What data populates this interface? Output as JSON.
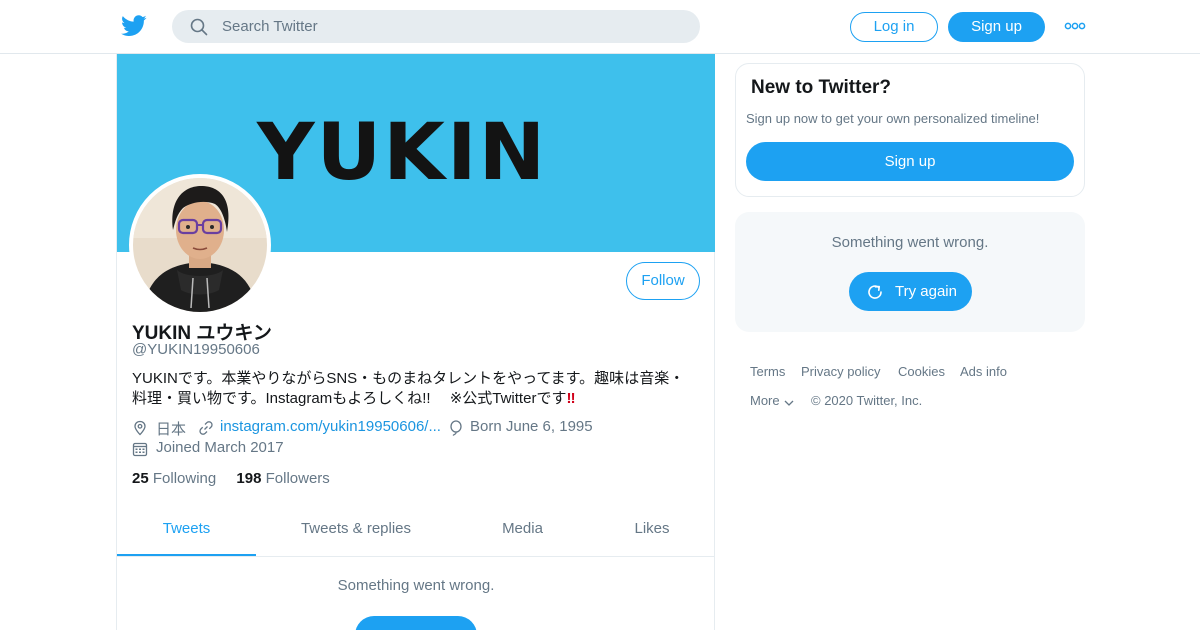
{
  "topbar": {
    "search_placeholder": "Search Twitter",
    "login_label": "Log in",
    "signup_label": "Sign up"
  },
  "profile": {
    "banner_text": "YUKIN",
    "follow_label": "Follow",
    "name": "YUKIN ユウキン",
    "handle": "@YUKIN19950606",
    "bio_line1": "YUKINです。本業やりながらSNS・ものまねタレントをやってます。趣味は音楽・",
    "bio_line2": "料理・買い物です。Instagramもよろしくね!!　 ※公式Twitterです",
    "bio_emoji": "‼",
    "location": "日本",
    "website": "instagram.com/yukin19950606/...",
    "birthday": "Born June 6, 1995",
    "joined": "Joined March 2017",
    "following_count": "25",
    "following_label": "Following",
    "followers_count": "198",
    "followers_label": "Followers"
  },
  "tabs": [
    {
      "label": "Tweets",
      "active": true
    },
    {
      "label": "Tweets & replies",
      "active": false
    },
    {
      "label": "Media",
      "active": false
    },
    {
      "label": "Likes",
      "active": false
    }
  ],
  "timeline": {
    "error_text": "Something went wrong."
  },
  "sidebar": {
    "new_title": "New to Twitter?",
    "new_subtitle": "Sign up now to get your own personalized timeline!",
    "new_signup_label": "Sign up",
    "error_text": "Something went wrong.",
    "try_again_label": "Try again"
  },
  "footer": {
    "terms": "Terms",
    "privacy": "Privacy policy",
    "cookies": "Cookies",
    "ads": "Ads info",
    "more": "More",
    "copyright": "© 2020 Twitter, Inc."
  },
  "colors": {
    "accent": "#1da1f2",
    "banner": "#3ec0ec",
    "secondary_text": "#657786"
  }
}
